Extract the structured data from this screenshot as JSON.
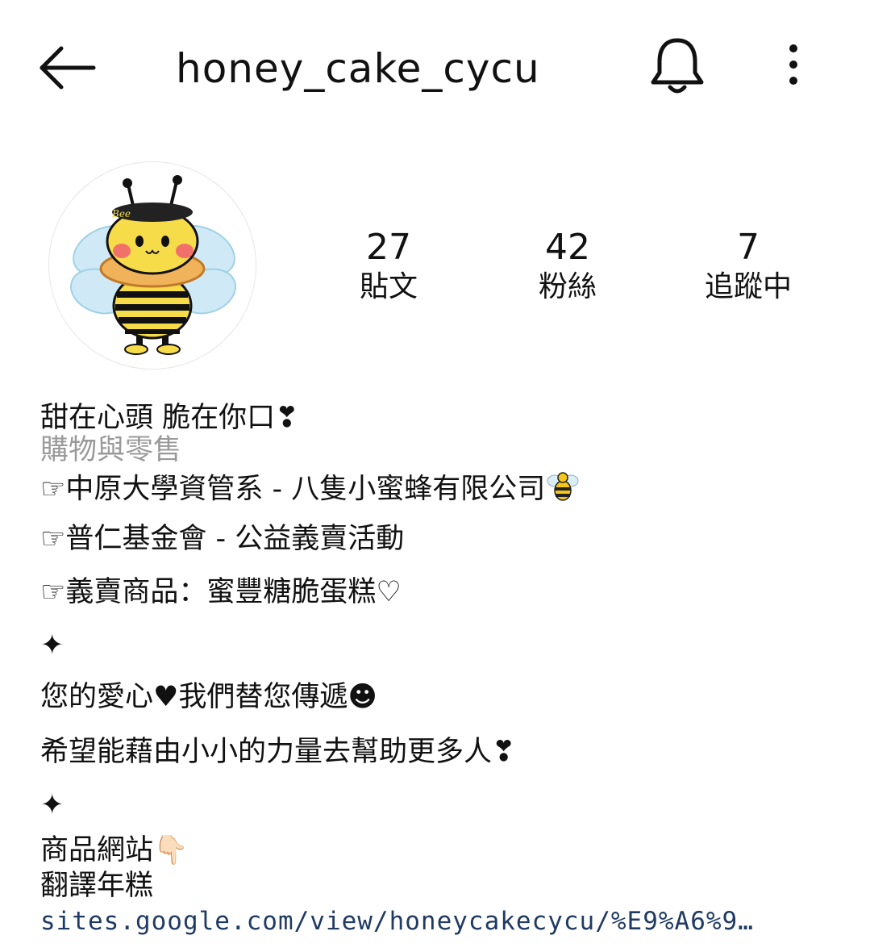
{
  "header": {
    "username": "honey_cake_cycu",
    "back_icon": "arrow-left-icon",
    "bell_icon": "bell-icon",
    "more_icon": "more-vertical-icon"
  },
  "profile": {
    "avatar_icon": "bee-avatar-icon",
    "stats": [
      {
        "value": "27",
        "label": "貼文"
      },
      {
        "value": "42",
        "label": "粉絲"
      },
      {
        "value": "7",
        "label": "追蹤中"
      }
    ]
  },
  "bio": {
    "line1": "甜在心頭 脆在你口❣",
    "category": "購物與零售",
    "line2": "☞中原大學資管系 - 八隻小蜜蜂有限公司",
    "line3": "☞普仁基金會 - 公益義賣活動",
    "line4": "☞義賣商品：蜜豐糖脆蛋糕♡",
    "sparkle1": "✦",
    "line5": "您的愛心♥我們替您傳遞☻",
    "line6": "希望能藉由小小的力量去幫助更多人❣",
    "sparkle2": "✦",
    "line7": "商品網站👇🏻",
    "line8": "翻譯年糕",
    "link": "sites.google.com/view/honeycakecycu/%E9%A6%9…"
  },
  "colors": {
    "link": "#1f3b63",
    "category": "#9a9a9a",
    "text": "#111111"
  }
}
